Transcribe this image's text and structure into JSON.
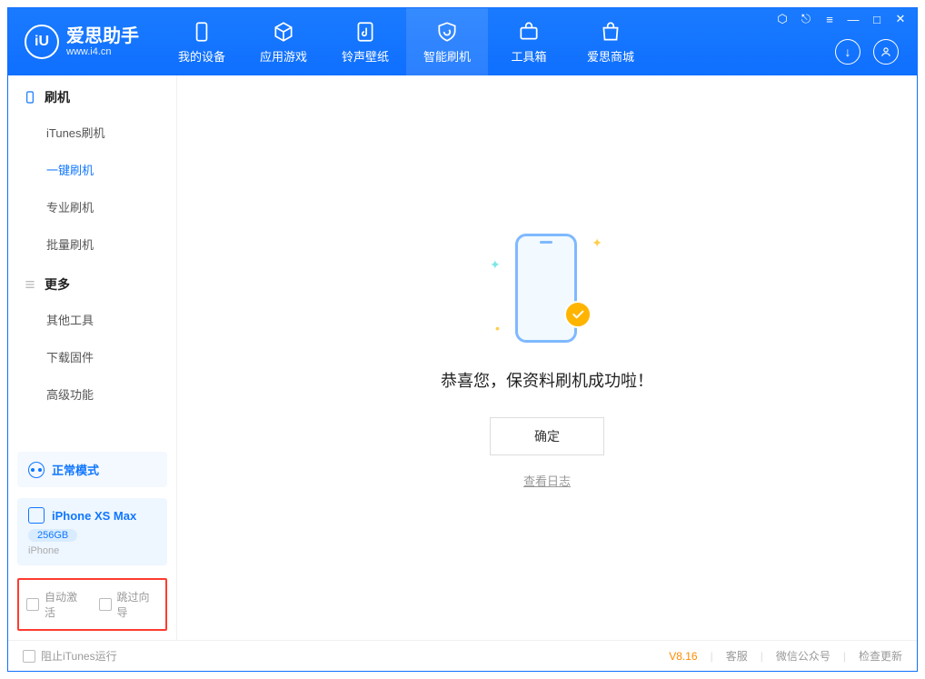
{
  "brand": {
    "title": "爱思助手",
    "sub": "www.i4.cn"
  },
  "tabs": [
    {
      "label": "我的设备"
    },
    {
      "label": "应用游戏"
    },
    {
      "label": "铃声壁纸"
    },
    {
      "label": "智能刷机"
    },
    {
      "label": "工具箱"
    },
    {
      "label": "爱思商城"
    }
  ],
  "sidebar": {
    "group1": {
      "title": "刷机",
      "items": [
        "iTunes刷机",
        "一键刷机",
        "专业刷机",
        "批量刷机"
      ],
      "active": 1
    },
    "group2": {
      "title": "更多",
      "items": [
        "其他工具",
        "下载固件",
        "高级功能"
      ]
    }
  },
  "device": {
    "mode": "正常模式",
    "name": "iPhone XS Max",
    "storage": "256GB",
    "type": "iPhone"
  },
  "options": {
    "auto_activate": "自动激活",
    "skip_guide": "跳过向导"
  },
  "main": {
    "message": "恭喜您，保资料刷机成功啦！",
    "ok": "确定",
    "view_log": "查看日志"
  },
  "footer": {
    "block_itunes": "阻止iTunes运行",
    "version": "V8.16",
    "links": [
      "客服",
      "微信公众号",
      "检查更新"
    ]
  }
}
